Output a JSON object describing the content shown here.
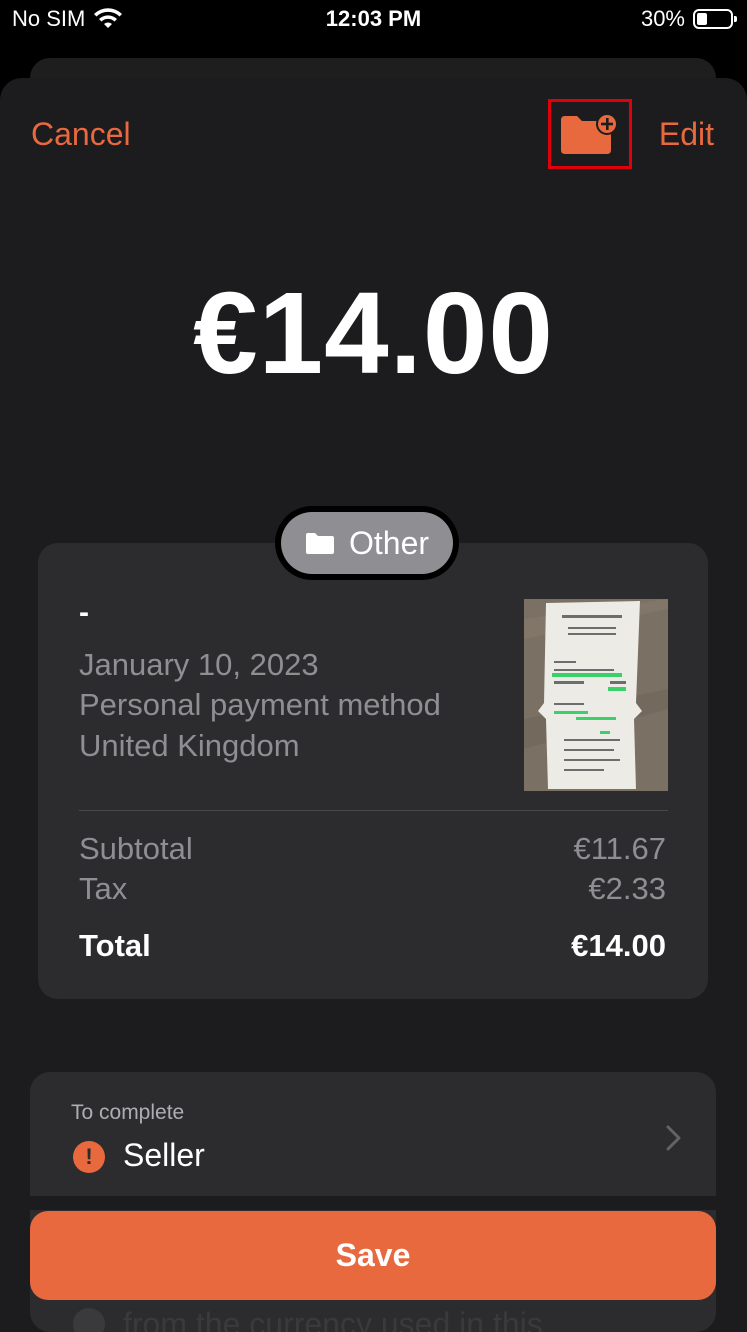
{
  "status_bar": {
    "carrier": "No SIM",
    "time": "12:03 PM",
    "battery": "30%"
  },
  "nav": {
    "cancel": "Cancel",
    "edit": "Edit"
  },
  "amount": "€14.00",
  "category": "Other",
  "receipt": {
    "merchant": "-",
    "date": "January 10, 2023",
    "payment_method": "Personal payment method",
    "country": "United Kingdom",
    "subtotal_label": "Subtotal",
    "subtotal": "€11.67",
    "tax_label": "Tax",
    "tax": "€2.33",
    "total_label": "Total",
    "total": "€14.00"
  },
  "to_complete": {
    "title": "To complete",
    "item_label": "Seller",
    "hidden_text": "from the currency used in this"
  },
  "save_button": "Save",
  "colors": {
    "accent": "#e8693e",
    "highlight_box": "#e0000b"
  }
}
